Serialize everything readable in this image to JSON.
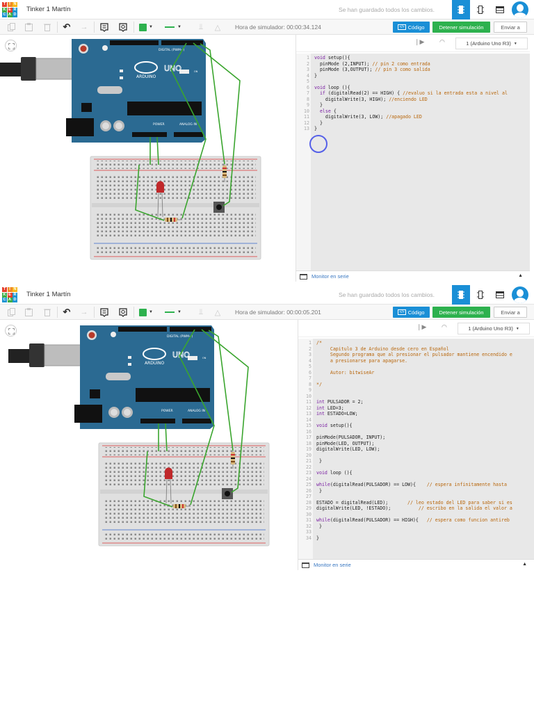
{
  "logo_letters": [
    "T",
    "I",
    "N",
    "K",
    "E",
    "R",
    "C",
    "A",
    "D"
  ],
  "logo_colors": [
    "#e5412d",
    "#f18a24",
    "#f6b81c",
    "#3fae49",
    "#e5412d",
    "#1c95d3",
    "#1c95d3",
    "#3fae49",
    "#1c95d3"
  ],
  "board": {
    "brand": "ARDUINO",
    "model": "UNO",
    "digital_label": "DIGITAL (PWM~)",
    "power_label": "POWER",
    "analog_label": "ANALOG IN",
    "on_label": "ON"
  },
  "colors": {
    "accent": "#1a8fd6",
    "run": "#2db14e",
    "wire": "#3aa52e",
    "board": "#2b6a92"
  },
  "panels": [
    {
      "app_title": "Tinker 1 Martín",
      "save_status": "Se han guardado todos los cambios.",
      "sim_time_label": "Hora de simulador:",
      "sim_time": "00:00:34.124",
      "code_button": "Código",
      "stop_button": "Detener simulación",
      "send_button": "Enviar a",
      "device_select": "1 (Arduino Uno R3)",
      "serial_monitor": "Monitor en serie",
      "code_lines": [
        "void setup(){",
        "  pinMode (2,INPUT); // pin 2 como entrada",
        "  pinMode (3,OUTPUT); // pin 3 como salida",
        "}",
        "",
        "void loop (){",
        "  if (digitalRead(2) == HIGH) { //evaluo si la entrada esta a nivel al",
        "    digitalWrite(3, HIGH); //enciendo LED",
        "  }",
        "  else {",
        "    digitalWrite(3, LOW); //apagado LED",
        "  }",
        "}"
      ]
    },
    {
      "app_title": "Tinker 1 Martín",
      "save_status": "Se han guardado todos los cambios.",
      "sim_time_label": "Hora de simulador:",
      "sim_time": "00:00:05.201",
      "code_button": "Código",
      "stop_button": "Detener simulación",
      "send_button": "Enviar a",
      "device_select": "1 (Arduino Uno R3)",
      "serial_monitor": "Monitor en serie",
      "code_lines": [
        "/*",
        "     Capitulo 3 de Arduino desde cero en Español",
        "     Segundo programa que al presionar el pulsador mantiene encendido e",
        "     a presionarse para apagarse.",
        "",
        "     Autor: bitwiseAr",
        "",
        "*/",
        "",
        "",
        "int PULSADOR = 2;",
        "int LED=3;",
        "int ESTADO=LOW;",
        "",
        "void setup(){",
        "",
        "pinMode(PULSADOR, INPUT);",
        "pinMode(LED, OUTPUT);",
        "digitalWrite(LED, LOW);",
        "",
        " }",
        "",
        "void loop (){",
        "",
        "while(digitalRead(PULSADOR) == LOW){    // espera infinitamente hasta",
        " }",
        "",
        "ESTADO = digitalRead(LED);       // leo estado del LED para saber si es",
        "digitalWrite(LED, !ESTADO);          // escribo en la salida el valor a",
        "",
        "while(digitalRead(PULSADOR) == HIGH){   // espera como funcion antireb",
        " }",
        "",
        "}"
      ]
    }
  ]
}
